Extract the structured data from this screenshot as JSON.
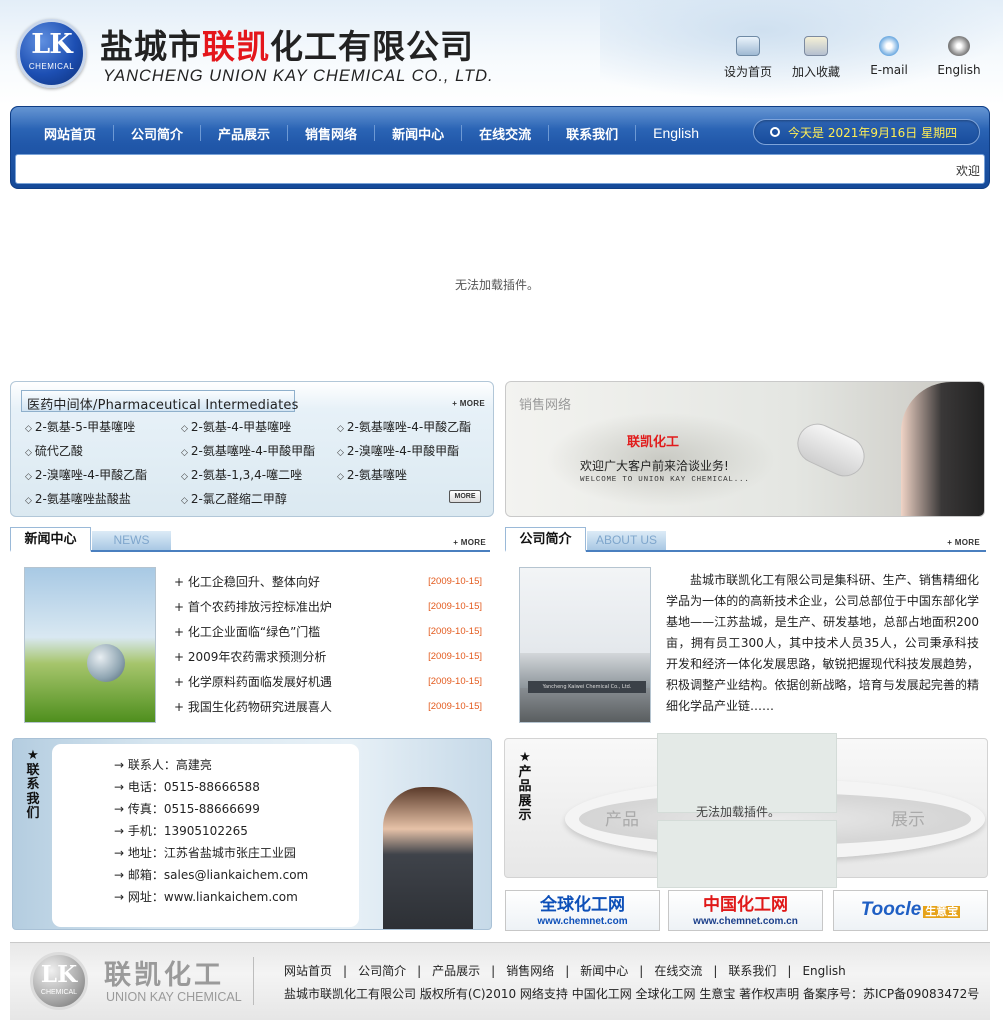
{
  "header": {
    "badge_letters": "LK",
    "badge_caption": "CHEMICAL",
    "company_cn_part1": "盐城市",
    "company_cn_part2": "联凯",
    "company_cn_part3": "化工有限公司",
    "company_en": "YANCHENG UNION KAY CHEMICAL CO., LTD.",
    "quick_links": [
      {
        "label": "设为首页",
        "icon": "monitor-icon"
      },
      {
        "label": "加入收藏",
        "icon": "bookmark-book-icon"
      },
      {
        "label": "E-mail",
        "icon": "email-globe-icon"
      },
      {
        "label": "English",
        "icon": "cd-disc-icon"
      }
    ]
  },
  "nav": {
    "items": [
      "网站首页",
      "公司简介",
      "产品展示",
      "销售网络",
      "新闻中心",
      "在线交流",
      "联系我们",
      "English"
    ],
    "date_text": "今天是 2021年9月16日 星期四",
    "marquee_text": "欢迎"
  },
  "flash": {
    "message": "无法加载插件。"
  },
  "pharma": {
    "title": "医药中间体/Pharmaceutical Intermediates",
    "more_label": "MORE",
    "items": [
      "2-氨基-5-甲基噻唑",
      "2-氨基-4-甲基噻唑",
      "2-氨基噻唑-4-甲酸乙酯",
      "硫代乙酸",
      "2-氨基噻唑-4-甲酸甲酯",
      "2-溴噻唑-4-甲酸甲酯",
      "2-溴噻唑-4-甲酸乙酯",
      "2-氨基-1,3,4-噻二唑",
      "2-氨基噻唑",
      "2-氨基噻唑盐酸盐",
      "2-氯乙醛缩二甲醇"
    ],
    "more_button_label": "MORE"
  },
  "sales": {
    "title": "销售网络",
    "brand": "联凯化工",
    "welcome": "欢迎广大客户前来洽谈业务!",
    "welcome_en": "WELCOME TO UNION KAY CHEMICAL..."
  },
  "news": {
    "tab_active": "新闻中心",
    "tab_inactive": "NEWS",
    "more_label": "MORE",
    "items": [
      {
        "title": "化工企稳回升、整体向好",
        "date": "[2009-10-15]"
      },
      {
        "title": "首个农药排放污控标准出炉",
        "date": "[2009-10-15]"
      },
      {
        "title": "化工企业面临“绿色”门槛",
        "date": "[2009-10-15]"
      },
      {
        "title": "2009年农药需求预测分析",
        "date": "[2009-10-15]"
      },
      {
        "title": "化学原料药面临发展好机遇",
        "date": "[2009-10-15]"
      },
      {
        "title": "我国生化药物研究进展喜人",
        "date": "[2009-10-15]"
      }
    ]
  },
  "about": {
    "tab_active": "公司简介",
    "tab_inactive": "ABOUT US",
    "more_label": "MORE",
    "image_sign": "Yancheng Kaiwei Chemical Co., Ltd.",
    "text": "盐城市联凯化工有限公司是集科研、生产、销售精细化学品为一体的的高新技术企业，公司总部位于中国东部化学基地——江苏盐城，是生产、研发基地，总部占地面积200亩，拥有员工300人，其中技术人员35人，公司秉承科技开发和经济一体化发展思路，敏锐把握现代科技发展趋势，积极调整产业结构。依据创新战略，培育与发展起完善的精细化学品产业链……"
  },
  "contact": {
    "label": "★联系我们",
    "rows": [
      "联系人：高建亮",
      "电话：0515-88666588",
      "传真：0515-88666699",
      "手机：13905102265",
      "地址：江苏省盐城市张庄工业园",
      "邮箱：sales@liankaichem.com",
      "网址：www.liankaichem.com"
    ]
  },
  "products": {
    "label": "★产品展示",
    "word_left": "产品",
    "word_right": "展示",
    "plugin_message": "无法加载插件。"
  },
  "banners": [
    {
      "main": "全球化工网",
      "sub": "www.chemnet.com"
    },
    {
      "main": "中国化工网",
      "sub": "www.chemnet.com.cn"
    },
    {
      "main": "Toocle",
      "badge": "生意宝"
    }
  ],
  "footer": {
    "badge_letters": "LK",
    "badge_caption": "CHEMICAL",
    "brand_cn": "联凯化工",
    "brand_en": "UNION KAY CHEMICAL",
    "links": [
      "网站首页",
      "公司简介",
      "产品展示",
      "销售网络",
      "新闻中心",
      "在线交流",
      "联系我们",
      "English"
    ],
    "copyright": "盐城市联凯化工有限公司 版权所有(C)2010 网络支持 中国化工网 全球化工网 生意宝 著作权声明 备案序号：苏ICP备09083472号"
  }
}
